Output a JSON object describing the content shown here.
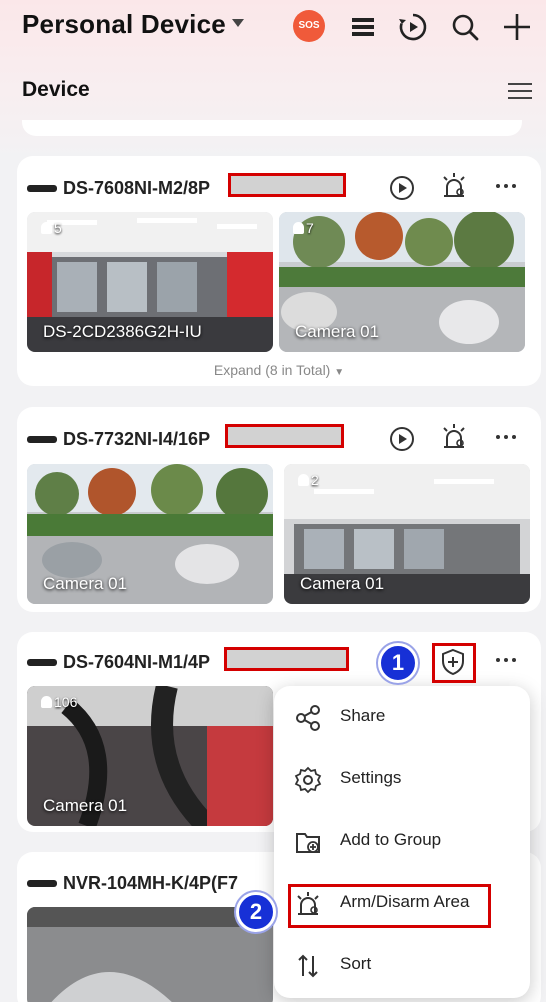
{
  "header": {
    "title": "Personal Device",
    "sos_label": "SOS",
    "section": "Device",
    "icons": [
      "sos-icon",
      "list-icon",
      "playback-icon",
      "search-icon",
      "add-icon",
      "menu-icon"
    ]
  },
  "devices": [
    {
      "name": "DS-7608NI-M2/8P",
      "icons": [
        "play-icon",
        "arm-alarm-icon",
        "more-icon"
      ],
      "cameras": [
        {
          "label": "DS-2CD2386G2H-IU",
          "badge": "5"
        },
        {
          "label": "Camera 01",
          "badge": "7"
        }
      ],
      "expand": "Expand (8 in Total)"
    },
    {
      "name": "DS-7732NI-I4/16P",
      "icons": [
        "play-icon",
        "arm-alarm-icon",
        "more-icon"
      ],
      "cameras": [
        {
          "label": "Camera 01",
          "badge": ""
        },
        {
          "label": "Camera 01",
          "badge": "2"
        }
      ]
    },
    {
      "name": "DS-7604NI-M1/4P",
      "icons": [
        "shield-plus-icon",
        "more-icon"
      ],
      "cameras": [
        {
          "label": "Camera 01",
          "badge": "106"
        }
      ]
    },
    {
      "name": "NVR-104MH-K/4P(F7",
      "cameras": []
    }
  ],
  "context_menu": {
    "items": [
      {
        "label": "Share",
        "icon": "share-icon"
      },
      {
        "label": "Settings",
        "icon": "settings-icon"
      },
      {
        "label": "Add to Group",
        "icon": "add-to-group-icon"
      },
      {
        "label": "Arm/Disarm Area",
        "icon": "arm-disarm-icon"
      },
      {
        "label": "Sort",
        "icon": "sort-icon"
      }
    ]
  },
  "annotations": {
    "step1": "1",
    "step2": "2"
  },
  "colors": {
    "accent_red": "#d40000",
    "step_blue": "#1730d6",
    "sos": "#f05a3a"
  }
}
